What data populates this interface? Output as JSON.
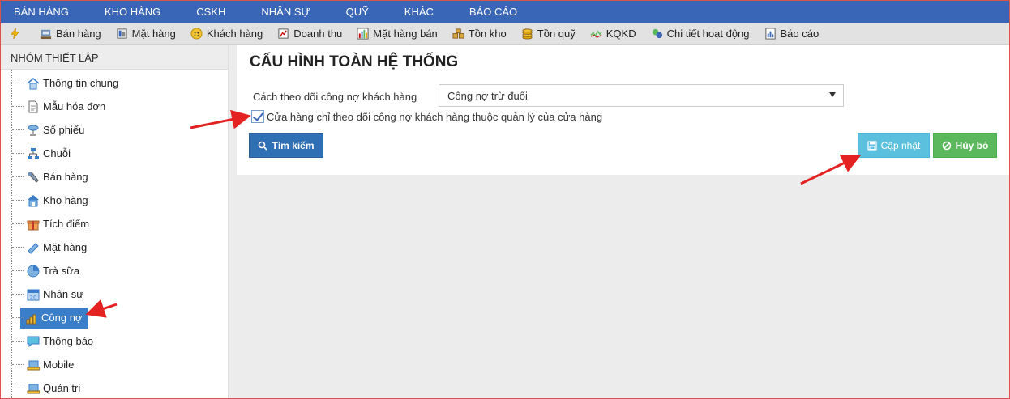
{
  "top_menu": [
    "BÁN HÀNG",
    "KHO HÀNG",
    "CSKH",
    "NHÂN SỰ",
    "QUỸ",
    "KHÁC",
    "BÁO CÁO"
  ],
  "toolbar": {
    "items": [
      {
        "label": "Bán hàng",
        "icon": "pos-icon"
      },
      {
        "label": "Mặt hàng",
        "icon": "product-icon"
      },
      {
        "label": "Khách hàng",
        "icon": "customer-icon"
      },
      {
        "label": "Doanh thu",
        "icon": "revenue-icon"
      },
      {
        "label": "Mặt hàng bán",
        "icon": "chart-icon"
      },
      {
        "label": "Tồn kho",
        "icon": "stock-icon"
      },
      {
        "label": "Tồn quỹ",
        "icon": "coins-icon"
      },
      {
        "label": "KQKD",
        "icon": "line-chart-icon"
      },
      {
        "label": "Chi tiết hoạt động",
        "icon": "activity-icon"
      },
      {
        "label": "Báo cáo",
        "icon": "report-icon"
      }
    ]
  },
  "sidebar": {
    "title": "NHÓM THIẾT LẬP",
    "items": [
      {
        "label": "Thông tin chung",
        "icon": "home-icon"
      },
      {
        "label": "Mẫu hóa đơn",
        "icon": "document-icon"
      },
      {
        "label": "Số phiếu",
        "icon": "network-icon"
      },
      {
        "label": "Chuỗi",
        "icon": "hierarchy-icon"
      },
      {
        "label": "Bán hàng",
        "icon": "tools-icon"
      },
      {
        "label": "Kho hàng",
        "icon": "warehouse-icon"
      },
      {
        "label": "Tích điểm",
        "icon": "gift-icon"
      },
      {
        "label": "Mặt hàng",
        "icon": "tag-icon"
      },
      {
        "label": "Trà sữa",
        "icon": "pie-icon"
      },
      {
        "label": "Nhân sự",
        "icon": "calendar-icon"
      },
      {
        "label": "Công nợ",
        "icon": "coins-icon"
      },
      {
        "label": "Thông báo",
        "icon": "chat-icon"
      },
      {
        "label": "Mobile",
        "icon": "mobile-icon"
      },
      {
        "label": "Quản trị",
        "icon": "admin-icon"
      }
    ]
  },
  "main": {
    "title": "CẤU HÌNH TOÀN HỆ THỐNG",
    "debt_tracking_label": "Cách theo dõi công nợ khách hàng",
    "debt_tracking_value": "Công nợ trừ đuổi",
    "store_only_checkbox_label": "Cửa hàng chỉ theo dõi công nợ khách hàng thuộc quản lý của cửa hàng",
    "store_only_checked": true,
    "search_button": "Tìm kiếm",
    "update_button": "Cập nhật",
    "cancel_button": "Hủy bỏ"
  },
  "colors": {
    "menu_bg": "#3a66b7",
    "active_item": "#3a7dc9",
    "update_btn": "#5bc0de",
    "cancel_btn": "#5cb85c",
    "search_btn": "#2f6fb3",
    "annotation_arrow": "#e52222"
  }
}
